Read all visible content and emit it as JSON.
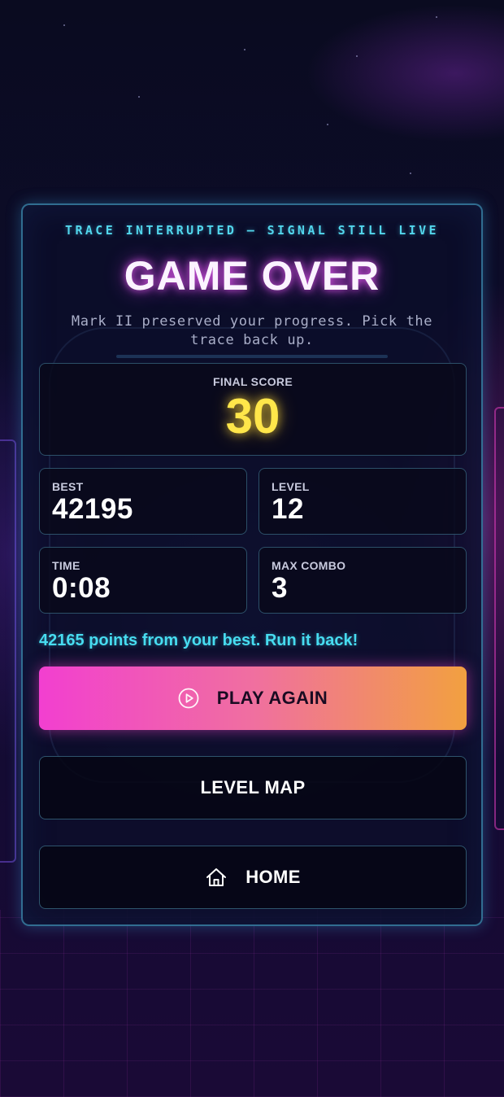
{
  "header": {
    "eyebrow": "TRACE INTERRUPTED — SIGNAL STILL LIVE",
    "title": "GAME OVER",
    "subtitle": "Mark II preserved your progress. Pick the trace back up."
  },
  "score": {
    "label": "FINAL SCORE",
    "value": "30"
  },
  "stats": {
    "best": {
      "label": "BEST",
      "value": "42195"
    },
    "level": {
      "label": "LEVEL",
      "value": "12"
    },
    "time": {
      "label": "TIME",
      "value": "0:08"
    },
    "combo": {
      "label": "MAX COMBO",
      "value": "3"
    }
  },
  "message": "42165 points from your best. Run it back!",
  "buttons": {
    "play_again": {
      "label": "PLAY AGAIN",
      "icon": "play-circle-icon"
    },
    "level_map": {
      "label": "LEVEL MAP"
    },
    "home": {
      "label": "HOME",
      "icon": "home-icon"
    }
  },
  "colors": {
    "accent_cyan": "#52d6ec",
    "title_glow": "#e05af0",
    "score_yellow": "#ffe64a",
    "button_gradient_start": "#f23fd0",
    "button_gradient_end": "#f2a040"
  }
}
